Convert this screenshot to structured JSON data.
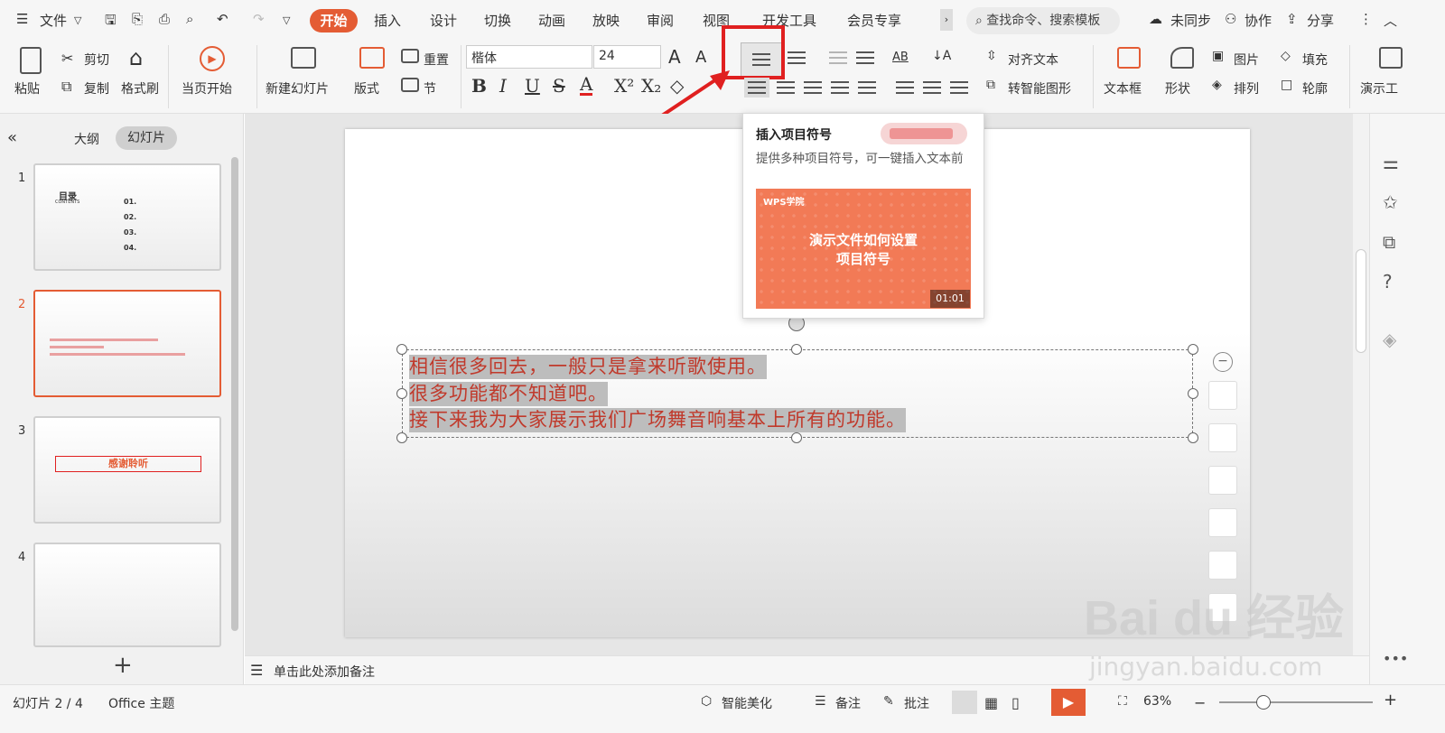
{
  "menu": {
    "file": "文件",
    "tabs": [
      "开始",
      "插入",
      "设计",
      "切换",
      "动画",
      "放映",
      "审阅",
      "视图",
      "开发工具",
      "会员专享"
    ],
    "search_placeholder": "查找命令、搜索模板",
    "sync": "未同步",
    "collab": "协作",
    "share": "分享"
  },
  "ribbon": {
    "paste": "粘贴",
    "cut": "剪切",
    "copy": "复制",
    "format_painter": "格式刷",
    "from_current": "当页开始",
    "new_slide": "新建幻灯片",
    "layout": "版式",
    "reset": "重置",
    "section": "节",
    "font_name": "楷体",
    "font_size": "24",
    "align_text": "对齐文本",
    "smart_shape": "转智能图形",
    "textbox": "文本框",
    "shape": "形状",
    "picture": "图片",
    "arrange": "排列",
    "fill": "填充",
    "outline": "轮廓",
    "presentation_tools": "演示工"
  },
  "leftpane": {
    "tab_outline": "大纲",
    "tab_slides": "幻灯片",
    "slide_numbers": [
      "1",
      "2",
      "3",
      "4"
    ],
    "thumb1_title": "目录",
    "thumb1_sub": "CONTENTS",
    "thumb1_items": [
      "01.",
      "02.",
      "03.",
      "04."
    ],
    "thumb3_text": "感谢聆听",
    "add": "+"
  },
  "slide": {
    "lines": [
      "相信很多回去，一般只是拿来听歌使用。",
      "很多功能都不知道吧。",
      "接下来我为大家展示我们广场舞音响基本上所有的功能。"
    ]
  },
  "tooltip": {
    "title": "插入项目符号",
    "desc": "提供多种项目符号，可一键插入文本前",
    "video_brand": "WPS学院",
    "video_title_1": "演示文件如何设置",
    "video_title_2": "项目符号",
    "video_duration": "01:01"
  },
  "notes": {
    "placeholder": "单击此处添加备注"
  },
  "status": {
    "slide_indicator": "幻灯片 2 / 4",
    "theme": "Office 主题",
    "smart_beautify": "智能美化",
    "notes": "备注",
    "comments": "批注",
    "zoom": "63%"
  },
  "watermark": {
    "brand": "Bai du 经验",
    "url": "jingyan.baidu.com"
  },
  "colors": {
    "accent": "#e45c34",
    "highlight_red": "#e02020",
    "slide_text": "#c0392b"
  }
}
